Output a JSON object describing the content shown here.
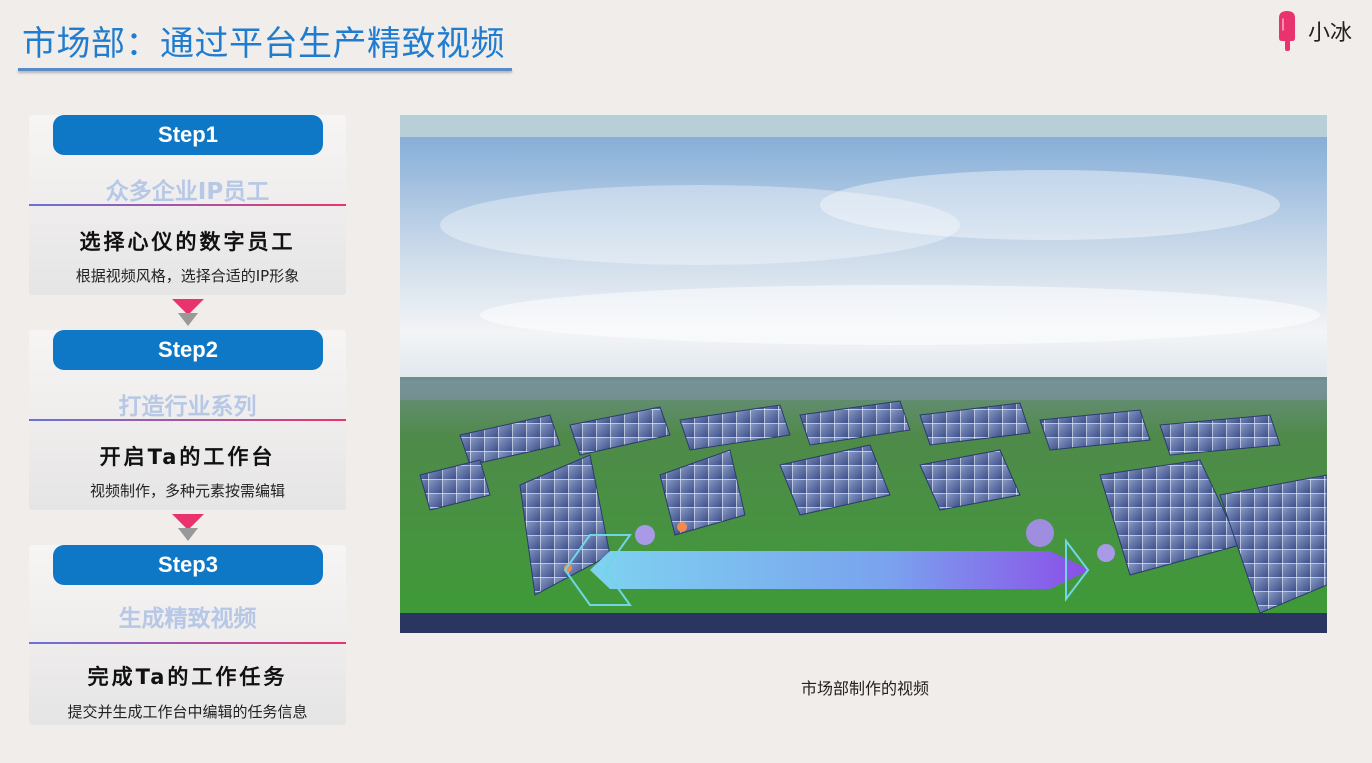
{
  "header": {
    "title": "市场部：通过平台生产精致视频"
  },
  "brand": {
    "name": "小冰",
    "logo_color": "#e8336e"
  },
  "steps": [
    {
      "label": "Step1",
      "subtitle": "众多企业IP员工",
      "heading": "选择心仪的数字员工",
      "description": "根据视频风格，选择合适的IP形象"
    },
    {
      "label": "Step2",
      "subtitle": "打造行业系列",
      "heading": "开启Ta的工作台",
      "description": "视频制作，多种元素按需编辑"
    },
    {
      "label": "Step3",
      "subtitle": "生成精致视频",
      "heading": "完成Ta的工作任务",
      "description": "提交并生成工作台中编辑的任务信息"
    }
  ],
  "video": {
    "caption": "市场部制作的视频"
  },
  "colors": {
    "accent": "#1f7ccf",
    "pill": "#0e78c6",
    "arrow": "#e8336e",
    "subtitle": "#b7c8e6"
  }
}
